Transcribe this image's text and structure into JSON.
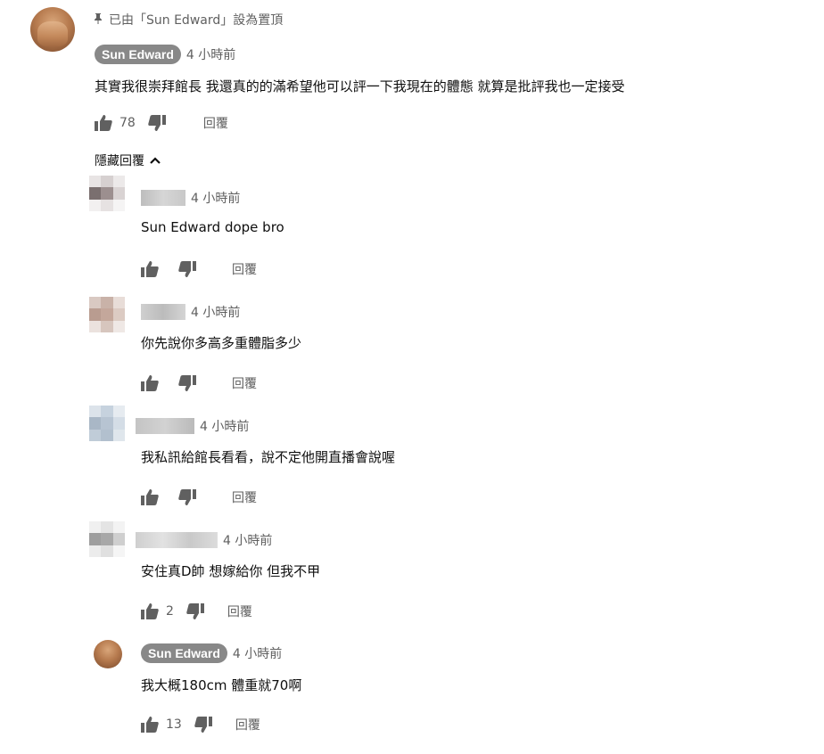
{
  "pinned": {
    "label": "已由「Sun Edward」設為置頂"
  },
  "top_comment": {
    "author": "Sun Edward",
    "time": "4 小時前",
    "text": "其實我很崇拜館長 我還真的的滿希望他可以評一下我現在的體態 就算是批評我也一定接受",
    "likes": "78",
    "reply_label": "回覆"
  },
  "replies_toggle": "隱藏回覆",
  "replies": [
    {
      "time": "4 小時前",
      "text": "Sun Edward dope bro",
      "likes": "",
      "reply_label": "回覆"
    },
    {
      "time": "4 小時前",
      "text": "你先說你多高多重體脂多少",
      "likes": "",
      "reply_label": "回覆"
    },
    {
      "time": "4 小時前",
      "text": "我私訊給館長看看，說不定他開直播會說喔",
      "likes": "",
      "reply_label": "回覆"
    },
    {
      "time": "4 小時前",
      "text": "安住真D帥 想嫁給你 但我不甲",
      "likes": "2",
      "reply_label": "回覆"
    },
    {
      "author": "Sun Edward",
      "time": "4 小時前",
      "text": "我大概180cm 體重就70啊",
      "likes": "13",
      "reply_label": "回覆"
    }
  ],
  "icons": {
    "like": "thumbs-up-icon",
    "dislike": "thumbs-down-icon",
    "pin": "pin-icon",
    "collapse": "chevron-up-icon"
  },
  "colors": {
    "chip_bg": "#888888",
    "secondary_text": "#606060",
    "primary_text": "#0f0f0f"
  }
}
